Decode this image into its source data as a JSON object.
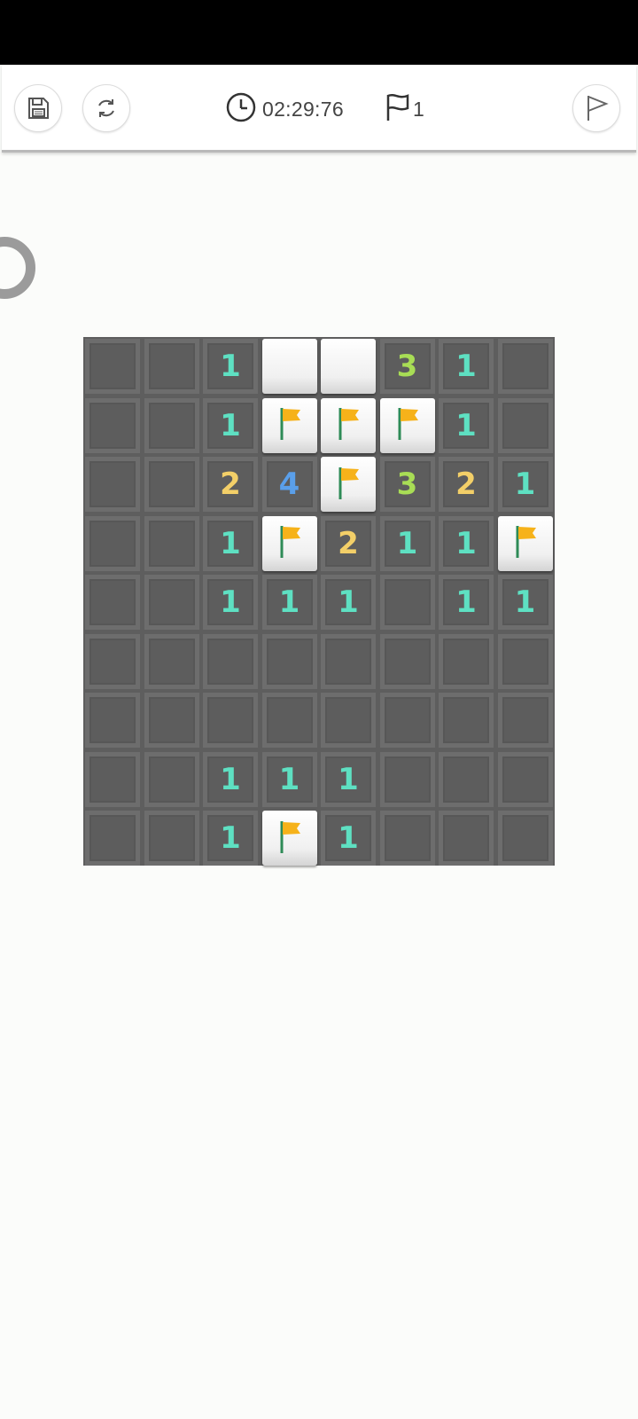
{
  "toolbar": {
    "timer": "02:29:76",
    "flag_count": "1"
  },
  "board": {
    "rows": 9,
    "cols": 8,
    "cells": [
      [
        "H",
        "H",
        "1",
        "R",
        "R",
        "3",
        "1",
        "H"
      ],
      [
        "H",
        "H",
        "1",
        "F",
        "F",
        "F",
        "1",
        "H"
      ],
      [
        "H",
        "H",
        "2",
        "4",
        "F",
        "3",
        "2",
        "1"
      ],
      [
        "H",
        "H",
        "1",
        "F",
        "2",
        "1",
        "1",
        "F"
      ],
      [
        "H",
        "H",
        "1",
        "1",
        "1",
        "E",
        "1",
        "1"
      ],
      [
        "H",
        "H",
        "E",
        "E",
        "E",
        "E",
        "E",
        "E"
      ],
      [
        "H",
        "H",
        "E",
        "E",
        "E",
        "E",
        "E",
        "E"
      ],
      [
        "H",
        "H",
        "1",
        "1",
        "1",
        "E",
        "E",
        "E"
      ],
      [
        "H",
        "H",
        "1",
        "F",
        "1",
        "E",
        "E",
        "E"
      ]
    ],
    "legend": {
      "H": "hidden",
      "R": "raised-unopened",
      "F": "flagged",
      "E": "empty",
      "digit": "number"
    }
  },
  "colors": {
    "num_1": "#5ee0c2",
    "num_2": "#f3cf68",
    "num_3": "#a8dd55",
    "num_4": "#5a9fea",
    "flag": "#f6b21a",
    "pole": "#2e8b57"
  },
  "icons": {
    "save": "save-icon",
    "restart": "restart-icon",
    "clock": "clock-icon",
    "flag": "flag-icon",
    "flag_mode": "flag-mode-icon"
  }
}
